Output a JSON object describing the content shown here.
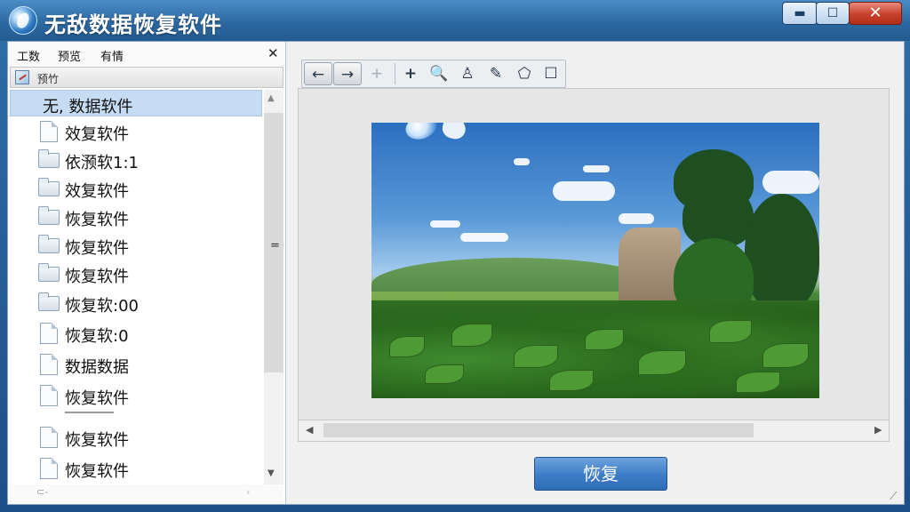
{
  "window": {
    "title": "无敌数据恢复软件",
    "controls": {
      "minimize": "▬",
      "maximize": "☐",
      "close": "✕"
    }
  },
  "left_panel": {
    "menu": [
      "工数",
      "预览",
      "有情"
    ],
    "close": "✕",
    "subbar_label": "预竹",
    "items": [
      {
        "label": "无, 数据软件",
        "icon": "none",
        "selected": true
      },
      {
        "label": "效复软件",
        "icon": "file-icon"
      },
      {
        "label": "依滪软1:1",
        "icon": "folder-icon"
      },
      {
        "label": "效复软件",
        "icon": "folder-icon"
      },
      {
        "label": "恢复软件",
        "icon": "folder-icon"
      },
      {
        "label": "恢复软件",
        "icon": "folder-icon"
      },
      {
        "label": "恢复软件",
        "icon": "folder-icon"
      },
      {
        "label": "恢复软:00",
        "icon": "folder-icon"
      },
      {
        "label": "恢复软:0",
        "icon": "file-icon"
      },
      {
        "label": "数据数据",
        "icon": "file-icon"
      },
      {
        "label": "恢复软件",
        "icon": "file-icon"
      },
      {
        "label": "恢复软件",
        "icon": "file-icon"
      },
      {
        "label": "恢复软件",
        "icon": "file-icon"
      }
    ],
    "scroll_grip": "="
  },
  "toolbar": {
    "back": "←",
    "forward": "→",
    "add_disabled": "+",
    "add": "+",
    "zoom": "🔍",
    "stamp": "♙",
    "pen": "✎",
    "tag": "⬠",
    "note": "☐"
  },
  "preview": {
    "image_alt": "landscape-photo"
  },
  "actions": {
    "recover": "恢复"
  },
  "colors": {
    "titlebar": "#2b679f",
    "selection": "#c6dcf3",
    "recover_button": "#3c7cc7",
    "close_button": "#c7412b"
  }
}
